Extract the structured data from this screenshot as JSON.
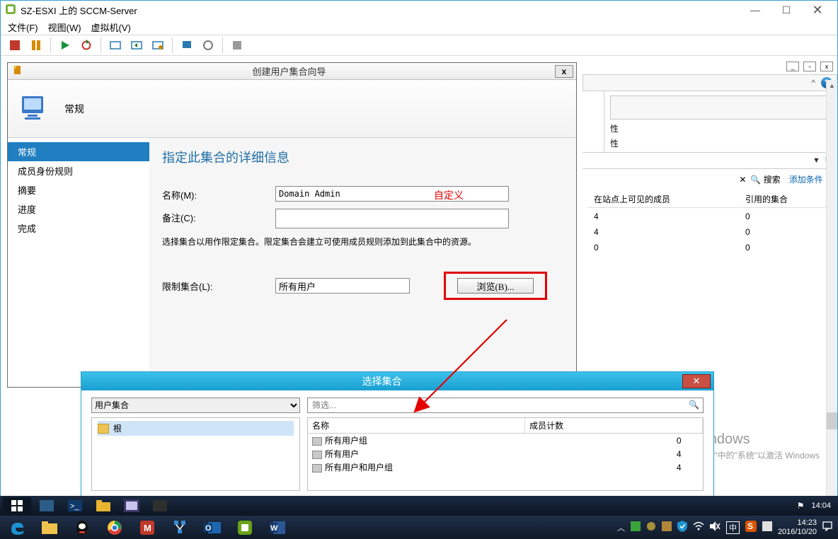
{
  "vsphere": {
    "title": "SZ-ESXI 上的 SCCM-Server",
    "menu": {
      "file": "文件(F)",
      "view": "视图(W)",
      "vm": "虚拟机(V)"
    },
    "win": {
      "min": "—",
      "max": "☐",
      "close": "✕"
    }
  },
  "mdiTop": {
    "helpGlyph": "?",
    "label1": "性",
    "label2": "性",
    "dropdown": "▼",
    "refresh": "↻",
    "clear": "✕",
    "searchIcon": "🔍",
    "searchLabel": "搜索",
    "addCond": "添加条件",
    "colVisible": "在站点上可见的成员",
    "colRef": "引用的集合",
    "rows": [
      {
        "visible": "4",
        "ref": "0"
      },
      {
        "visible": "4",
        "ref": "0"
      },
      {
        "visible": "0",
        "ref": "0"
      }
    ]
  },
  "wizard": {
    "title": "创建用户集合向导",
    "close": "x",
    "headerLabel": "常规",
    "nav": {
      "general": "常规",
      "membership": "成员身份规则",
      "summary": "摘要",
      "progress": "进度",
      "complete": "完成"
    },
    "contentTitle": "指定此集合的详细信息",
    "nameLabel": "名称(M):",
    "nameValue": "Domain Admin",
    "customNote": "自定义",
    "commentLabel": "备注(C):",
    "commentValue": "",
    "hint": "选择集合以用作限定集合。限定集合会建立可使用成员规则添加到此集合中的资源。",
    "limitLabel": "限制集合(L):",
    "limitValue": "所有用户",
    "browse": "浏览(B)..."
  },
  "selcoll": {
    "title": "选择集合",
    "close": "✕",
    "dropdown": "用户集合",
    "root": "根",
    "filterPlaceholder": "筛选...",
    "colName": "名称",
    "colCount": "成员计数",
    "rows": [
      {
        "name": "所有用户组",
        "count": "0"
      },
      {
        "name": "所有用户",
        "count": "4"
      },
      {
        "name": "所有用户和用户组",
        "count": "4"
      }
    ]
  },
  "watermark": {
    "l1": "激活 Windows",
    "l2": "转到\"控制面板\"中的\"系统\"以激活 Windows"
  },
  "taskbarBack": {
    "time": "14:04"
  },
  "taskbarFront": {
    "ime": "中",
    "time": "14:23",
    "date": "2016/10/20"
  }
}
